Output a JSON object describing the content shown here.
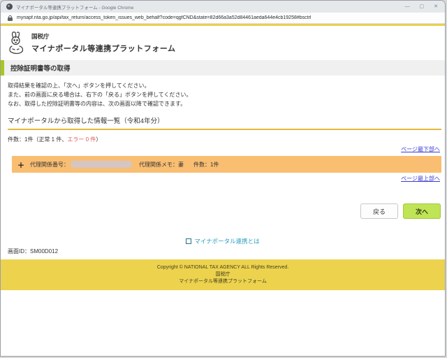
{
  "browser": {
    "title": "マイナポータル等連携プラットフォーム - Google Chrome",
    "url": "mynapf.nta.go.jp/api/tax_return/access_token_issues_web_behalf?code=qgfCND&state=82d66a3a52d84461aeda644e4cb19258#bsctrl",
    "controls": {
      "minimize": "—",
      "maximize": "▢",
      "close": "✕"
    }
  },
  "header": {
    "agency": "国税庁",
    "platform": "マイナポータル等連携プラットフォーム"
  },
  "page": {
    "section_title": "控除証明書等の取得",
    "instructions": [
      "取得結果を確認の上、「次へ」ボタンを押してください。",
      "また、前の画面に戻る場合は、右下の「戻る」ボタンを押してください。",
      "なお、取得した控除証明書等の内容は、次の画面以降で確認できます。"
    ],
    "list_title": "マイナポータルから取得した情報一覧（令和4年分）",
    "count_prefix": "件数：1件（正常 1 件、",
    "count_error": "エラー 0 件",
    "count_suffix": "）",
    "link_to_bottom": "ページ最下部へ",
    "link_to_top": "ページ最上部へ",
    "record": {
      "expand_icon": "＋",
      "number_label": "代理関係番号：",
      "memo_label": "代理関係メモ：妻",
      "count_label": "件数：1件"
    },
    "buttons": {
      "back": "戻る",
      "next": "次へ"
    },
    "about_link": "マイナポータル連携とは",
    "screen_id": "画面ID：SM00D012"
  },
  "footer": {
    "copyright": "Copyright © NATIONAL TAX AGENCY ALL Rights Reserved.",
    "agency": "国税庁",
    "platform": "マイナポータル等連携プラットフォーム"
  },
  "colors": {
    "accent_yellow": "#e9d04f",
    "accent_green": "#a9c71e",
    "record_orange": "#f9be72",
    "next_button_green": "#bfe455",
    "error_red": "#e05a5a",
    "link_blue": "#3a3ad0",
    "about_link_teal": "#2f9dc0"
  }
}
